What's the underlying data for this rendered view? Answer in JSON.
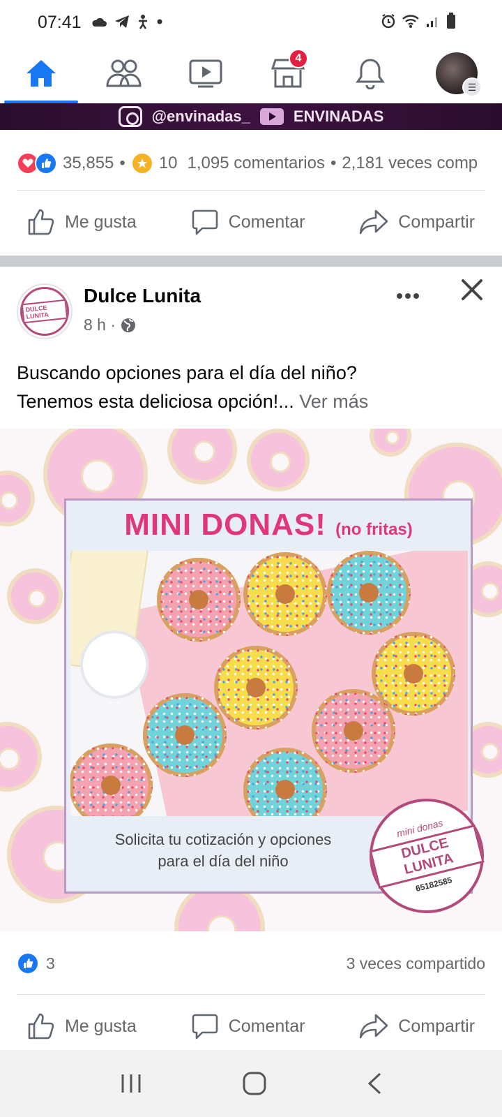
{
  "status_bar": {
    "time": "07:41"
  },
  "top_nav": {
    "tabs": [
      {
        "name": "home",
        "active": true
      },
      {
        "name": "friends",
        "active": false
      },
      {
        "name": "watch",
        "active": false
      },
      {
        "name": "marketplace",
        "active": false,
        "badge": "4"
      },
      {
        "name": "notifications",
        "active": false
      },
      {
        "name": "profile-menu",
        "active": false
      }
    ]
  },
  "prev_post": {
    "banner_instagram": "@envinadas_",
    "banner_youtube": "ENVINADAS",
    "reactions_count": "35,855",
    "stars_count": "10",
    "comments": "1,095 comentarios",
    "shares": "2,181 veces comp",
    "actions": {
      "like": "Me gusta",
      "comment": "Comentar",
      "share": "Compartir"
    }
  },
  "post": {
    "page_name": "Dulce Lunita",
    "time": "8 h ·",
    "text_line1": "Buscando opciones para el día del niño?",
    "text_line2": "Tenemos esta deliciosa opción!...",
    "see_more": "Ver más",
    "image": {
      "title": "MINI DONAS!",
      "title_suffix": "(no fritas)",
      "caption_line1": "Solicita tu cotización y opciones",
      "caption_line2": "para el día del niño",
      "logo_top": "mini donas",
      "logo_name": "DULCE LUNITA",
      "logo_phone": "65182585",
      "avatar_logo": "DULCE LUNITA"
    },
    "likes": "3",
    "shares": "3 veces compartido",
    "actions": {
      "like": "Me gusta",
      "comment": "Comentar",
      "share": "Compartir"
    }
  },
  "colors": {
    "accent": "#1877f2",
    "badge": "#e41e3f",
    "brand_pink": "#e0357f"
  }
}
